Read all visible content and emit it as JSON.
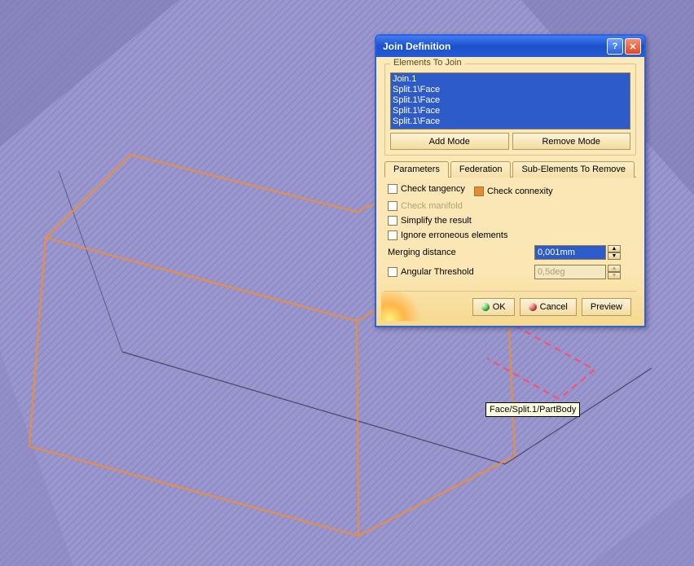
{
  "viewport": {
    "tooltip": "Face/Split.1/PartBody"
  },
  "dialog": {
    "title": "Join Definition",
    "group_title": "Elements To Join",
    "list_items": [
      "Join.1",
      "Split.1\\Face",
      "Split.1\\Face",
      "Split.1\\Face",
      "Split.1\\Face"
    ],
    "add_mode": "Add Mode",
    "remove_mode": "Remove Mode",
    "tabs": {
      "parameters": "Parameters",
      "federation": "Federation",
      "subelements": "Sub-Elements To Remove"
    },
    "checks": {
      "tangency": "Check tangency",
      "connexity": "Check connexity",
      "manifold": "Check manifold",
      "simplify": "Simplify the result",
      "ignore_err": "Ignore erroneous elements"
    },
    "merging_label": "Merging distance",
    "merging_value": "0,001mm",
    "angular_label": "Angular Threshold",
    "angular_value": "0,5deg",
    "buttons": {
      "ok": "OK",
      "cancel": "Cancel",
      "preview": "Preview"
    }
  }
}
